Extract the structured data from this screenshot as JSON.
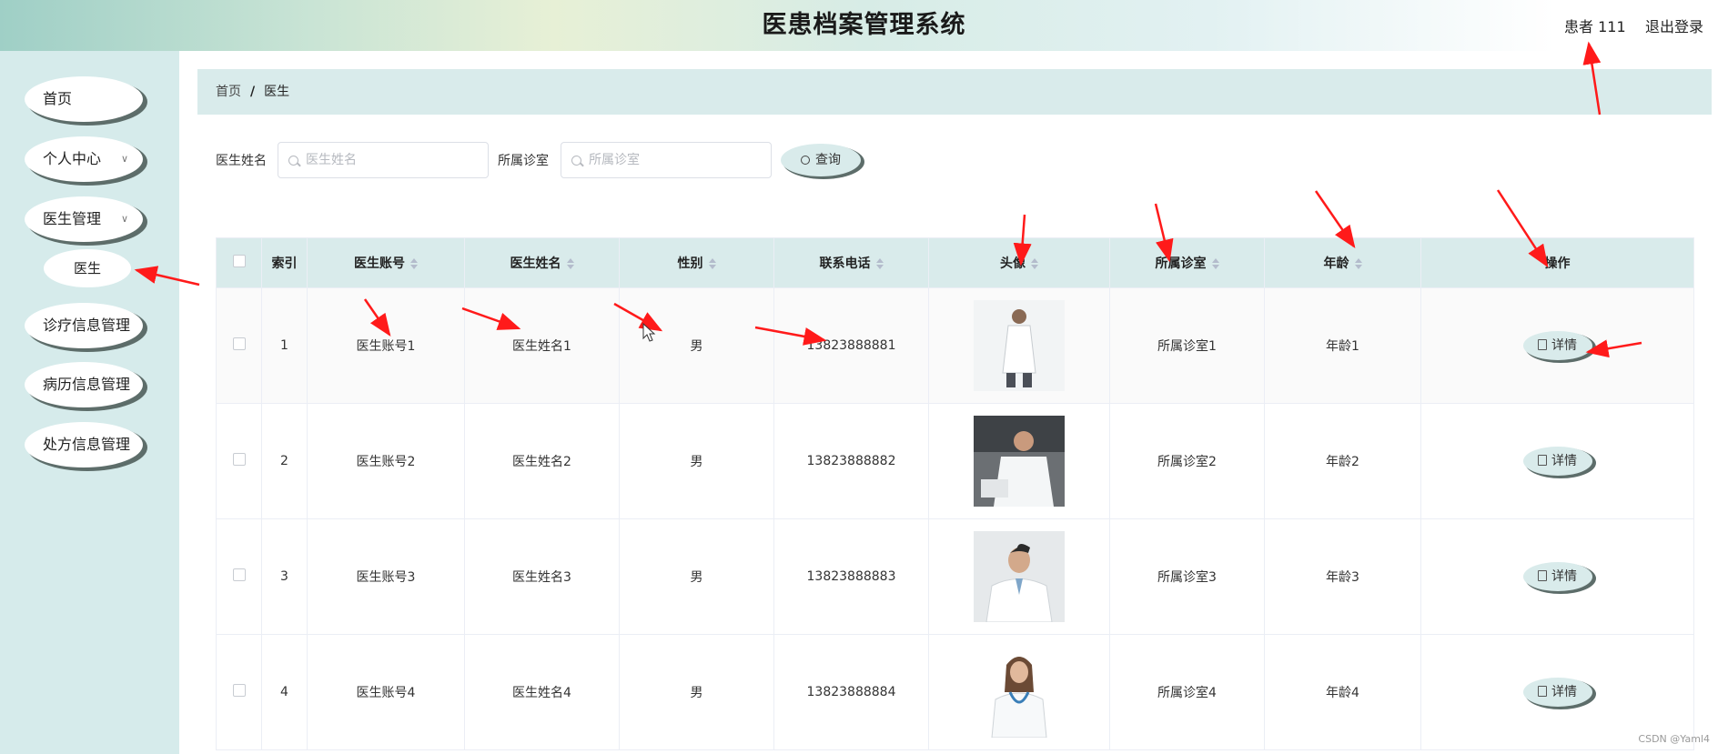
{
  "header": {
    "title": "医患档案管理系统",
    "user": "患者 111",
    "logout": "退出登录"
  },
  "sidebar": {
    "items": [
      {
        "label": "首页"
      },
      {
        "label": "个人中心"
      },
      {
        "label": "医生管理"
      },
      {
        "label": "诊疗信息管理"
      },
      {
        "label": "病历信息管理"
      },
      {
        "label": "处方信息管理"
      }
    ],
    "sub_item": "医生",
    "chevron": "chevron-down-icon"
  },
  "breadcrumb": {
    "home": "首页",
    "sep": "/",
    "current": "医生"
  },
  "filters": {
    "name_label": "医生姓名",
    "name_placeholder": "医生姓名",
    "clinic_label": "所属诊室",
    "clinic_placeholder": "所属诊室",
    "query_button": "查询"
  },
  "table": {
    "headers": {
      "index": "索引",
      "account": "医生账号",
      "name": "医生姓名",
      "gender": "性别",
      "phone": "联系电话",
      "avatar": "头像",
      "clinic": "所属诊室",
      "age": "年龄",
      "action": "操作"
    },
    "rows": [
      {
        "index": "1",
        "account": "医生账号1",
        "name": "医生姓名1",
        "gender": "男",
        "phone": "13823888881",
        "clinic": "所属诊室1",
        "age": "年龄1",
        "action": "详情"
      },
      {
        "index": "2",
        "account": "医生账号2",
        "name": "医生姓名2",
        "gender": "男",
        "phone": "13823888882",
        "clinic": "所属诊室2",
        "age": "年龄2",
        "action": "详情"
      },
      {
        "index": "3",
        "account": "医生账号3",
        "name": "医生姓名3",
        "gender": "男",
        "phone": "13823888883",
        "clinic": "所属诊室3",
        "age": "年龄3",
        "action": "详情"
      },
      {
        "index": "4",
        "account": "医生账号4",
        "name": "医生姓名4",
        "gender": "男",
        "phone": "13823888884",
        "clinic": "所属诊室4",
        "age": "年龄4",
        "action": "详情"
      }
    ]
  },
  "watermark": "CSDN @Yaml4",
  "colors": {
    "sidebar_bg": "#d6ebeb",
    "header_bg": "#d9ebeb",
    "button_shadow": "#5d6d6a",
    "annotation_arrow": "#ff1a1a"
  }
}
